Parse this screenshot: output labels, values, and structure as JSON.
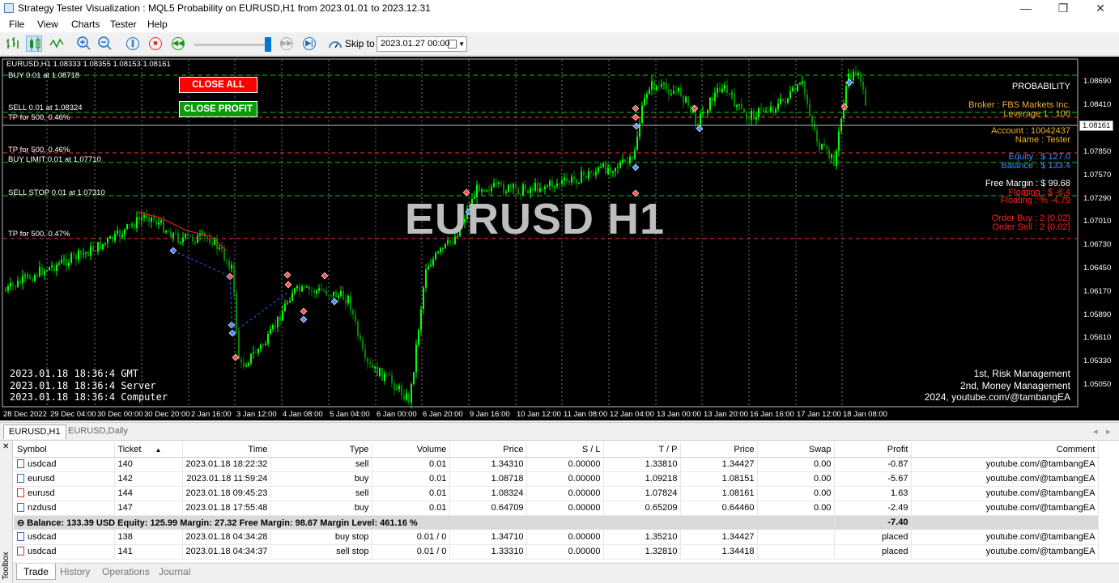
{
  "window": {
    "title": "Strategy Tester Visualization : MQL5 Probability on EURUSD,H1 from 2023.01.01 to 2023.12.31",
    "minimize": "—",
    "restore": "❐",
    "close": "✕"
  },
  "menu": [
    "File",
    "View",
    "Charts",
    "Tester",
    "Help"
  ],
  "toolbar": {
    "skip_label": "Skip to",
    "skip_value": "2023.01.27 00:00"
  },
  "chart": {
    "header": "EURUSD,H1  1.08333 1.08355 1.08153 1.08161",
    "watermark": "EURUSD H1",
    "close_all": "CLOSE ALL",
    "close_profit": "CLOSE PROFIT",
    "levels": [
      {
        "label": "BUY 0.01 at 1.08718",
        "color": "#00cc00",
        "dash": "6,4"
      },
      {
        "label": "SELL 0.01 at 1.08324",
        "color": "#00cc00",
        "dash": "6,4"
      },
      {
        "label": "TP for 500, 0.46%",
        "color": "#ff3030",
        "dash": "5,4"
      },
      {
        "label": "TP for 500, 0.46%",
        "color": "#ff3030",
        "dash": "5,4"
      },
      {
        "label": "BUY LIMIT 0.01 at 1.07710",
        "color": "#00cc00",
        "dash": "6,4"
      },
      {
        "label": "SELL STOP 0.01 at 1.07310",
        "color": "#00cc00",
        "dash": "6,4"
      },
      {
        "label": "TP for 500, 0.47%",
        "color": "#ff3030",
        "dash": "5,4"
      }
    ],
    "info": {
      "probability": "PROBABILITY",
      "broker": "Broker : FBS Markets Inc.",
      "leverage": "Leverage 1 : 100",
      "account": "Account : 10042437",
      "name": "Name : Tester",
      "equity": "Equity : $ 127.0",
      "balance": "Balance : $ 133.4",
      "free_margin": "Free Margin : $ 99.68",
      "floating_usd": "Floating : $ -6.4",
      "floating_pct": "Floating : % -4.79",
      "order_buy": "Order Buy : 2 (0.02)",
      "order_sell": "Order Sell : 2 (0.02)"
    },
    "times": {
      "gmt": "2023.01.18 18:36:4 GMT",
      "server": "2023.01.18 18:36:4 Server",
      "computer": "2023.01.18 18:36:4 Computer"
    },
    "credits": {
      "line1": "1st, Risk Management",
      "line2": "2nd, Money Management",
      "line3": "2024, youtube.com/@tambangEA"
    },
    "price_ticks": [
      "1.08690",
      "1.08410",
      "1.08161",
      "1.07850",
      "1.07570",
      "1.07290",
      "1.07010",
      "1.06730",
      "1.06450",
      "1.06170",
      "1.05890",
      "1.05610",
      "1.05330",
      "1.05050"
    ],
    "current_price": "1.08161",
    "time_ticks": [
      "28 Dec 2022",
      "29 Dec 04:00",
      "30 Dec 00:00",
      "30 Dec 20:00",
      "2 Jan 16:00",
      "3 Jan 12:00",
      "4 Jan 08:00",
      "5 Jan 04:00",
      "6 Jan 00:00",
      "6 Jan 20:00",
      "9 Jan 16:00",
      "10 Jan 12:00",
      "11 Jan 08:00",
      "12 Jan 04:00",
      "13 Jan 00:00",
      "13 Jan 20:00",
      "16 Jan 16:00",
      "17 Jan 12:00",
      "18 Jan 08:00"
    ],
    "colors": {
      "bull": "#00ff00",
      "bear": "#008800",
      "bg": "#000000"
    }
  },
  "chart_tabs": [
    "EURUSD,H1",
    "EURUSD,Daily"
  ],
  "trade": {
    "columns": [
      "Symbol",
      "Ticket",
      "Time",
      "Type",
      "Volume",
      "Price",
      "S / L",
      "T / P",
      "Price",
      "Swap",
      "Profit",
      "Comment"
    ],
    "sort_arrow": "▲",
    "open_positions": [
      {
        "symbol": "usdcad",
        "ticket": "140",
        "time": "2023.01.18 18:22:32",
        "type": "sell",
        "volume": "0.01",
        "price": "1.34310",
        "sl": "0.00000",
        "tp": "1.33810",
        "cur_price": "1.34427",
        "swap": "0.00",
        "profit": "-0.87",
        "comment": "youtube.com/@tambangEA",
        "icon": "sell"
      },
      {
        "symbol": "eurusd",
        "ticket": "142",
        "time": "2023.01.18 11:59:24",
        "type": "buy",
        "volume": "0.01",
        "price": "1.08718",
        "sl": "0.00000",
        "tp": "1.09218",
        "cur_price": "1.08151",
        "swap": "0.00",
        "profit": "-5.67",
        "comment": "youtube.com/@tambangEA",
        "icon": "buy"
      },
      {
        "symbol": "eurusd",
        "ticket": "144",
        "time": "2023.01.18 09:45:23",
        "type": "sell",
        "volume": "0.01",
        "price": "1.08324",
        "sl": "0.00000",
        "tp": "1.07824",
        "cur_price": "1.08161",
        "swap": "0.00",
        "profit": "1.63",
        "comment": "youtube.com/@tambangEA",
        "icon": "sell"
      },
      {
        "symbol": "nzdusd",
        "ticket": "147",
        "time": "2023.01.18 17:55:48",
        "type": "buy",
        "volume": "0.01",
        "price": "0.64709",
        "sl": "0.00000",
        "tp": "0.65209",
        "cur_price": "0.64460",
        "swap": "0.00",
        "profit": "-2.49",
        "comment": "youtube.com/@tambangEA",
        "icon": "buy"
      }
    ],
    "summary": {
      "text": "Balance: 133.39 USD  Equity: 125.99  Margin: 27.32  Free Margin: 98.67  Margin Level: 461.16 %",
      "profit": "-7.40"
    },
    "pending_orders": [
      {
        "symbol": "usdcad",
        "ticket": "138",
        "time": "2023.01.18 04:34:28",
        "type": "buy stop",
        "volume": "0.01 / 0",
        "price": "1.34710",
        "sl": "0.00000",
        "tp": "1.35210",
        "cur_price": "1.34427",
        "swap": "",
        "profit": "placed",
        "comment": "youtube.com/@tambangEA",
        "icon": "buy"
      },
      {
        "symbol": "usdcad",
        "ticket": "141",
        "time": "2023.01.18 04:34:37",
        "type": "sell stop",
        "volume": "0.01 / 0",
        "price": "1.33310",
        "sl": "0.00000",
        "tp": "1.32810",
        "cur_price": "1.34418",
        "swap": "",
        "profit": "placed",
        "comment": "youtube.com/@tambangEA",
        "icon": "sell"
      }
    ]
  },
  "toolbox_label": "Toolbox",
  "bottom_tabs": [
    "Trade",
    "History",
    "Operations",
    "Journal"
  ]
}
